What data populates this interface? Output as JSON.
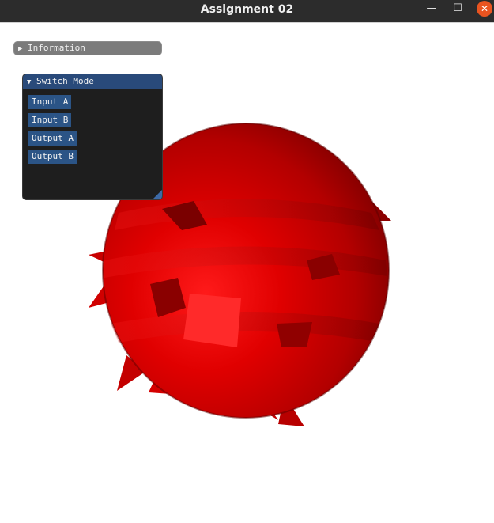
{
  "window": {
    "title": "Assignment 02",
    "controls": {
      "minimize": "—",
      "maximize": "☐",
      "close": "✕"
    }
  },
  "info_panel": {
    "arrow": "▶",
    "label": "Information",
    "expanded": false
  },
  "mode_panel": {
    "arrow": "▼",
    "label": "Switch Mode",
    "expanded": true,
    "buttons": [
      "Input A",
      "Input B",
      "Output A",
      "Output B"
    ]
  },
  "scene": {
    "object": "deformed-sphere-mesh",
    "color": "#e00000",
    "background": "#ffffff"
  },
  "colors": {
    "titlebar": "#2c2c2c",
    "close_button": "#e95420",
    "panel_header": "#294a7a",
    "button": "#2b5486",
    "panel_bg": "#1e1e1e"
  }
}
